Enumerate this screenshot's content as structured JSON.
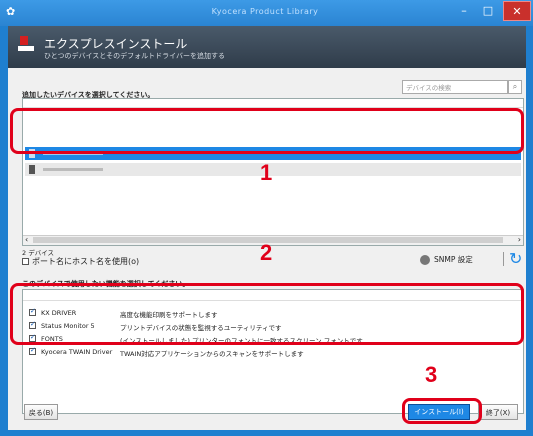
{
  "window": {
    "title": "Kyocera Product Library"
  },
  "header": {
    "title": "エクスプレスインストール",
    "subtitle": "ひとつのデバイスとそのデフォルトドライバーを追加する"
  },
  "device_section": {
    "label": "追加したいデバイスを選択してください。",
    "search_placeholder": "デバイスの検索",
    "count": "2 デバイス",
    "port_checkbox_label": "ポート名にホスト名を使用(o)",
    "snmp_label": "SNMP 設定"
  },
  "feature_section": {
    "label": "このデバイスで使用したい機能を選択してください。",
    "items": [
      {
        "name": "KX DRIVER",
        "desc": "高度な機能印刷をサポートします"
      },
      {
        "name": "Status Monitor 5",
        "desc": "プリントデバイスの状態を監視するユーティリティです"
      },
      {
        "name": "FONTS",
        "desc": "(インストールしました) プリンターのフォントに一致するスクリーン フォントです"
      },
      {
        "name": "Kyocera TWAIN Driver",
        "desc": "TWAIN対応アプリケーションからのスキャンをサポートします"
      }
    ]
  },
  "buttons": {
    "back": "戻る(B)",
    "install": "インストール(I)",
    "exit": "終了(X)"
  },
  "callouts": {
    "one": "1",
    "two": "2",
    "three": "3"
  }
}
